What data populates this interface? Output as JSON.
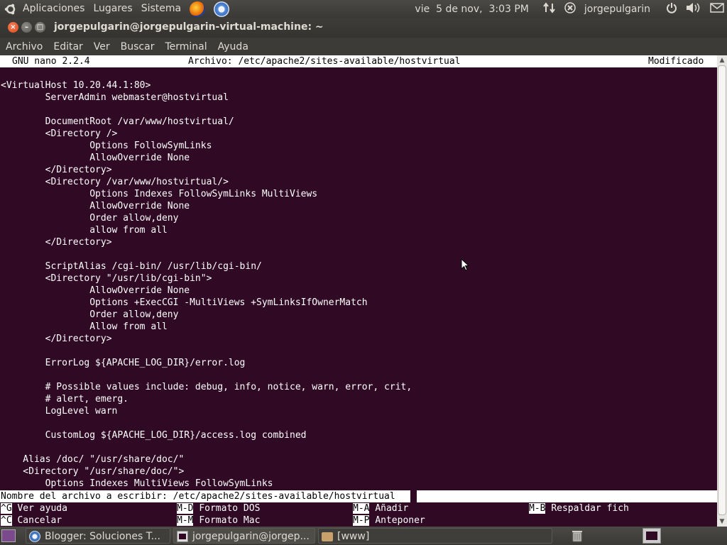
{
  "top_panel": {
    "menus": [
      "Aplicaciones",
      "Lugares",
      "Sistema"
    ],
    "datetime": "vie  5 de nov,  3:03 PM",
    "user": "jorgepulgarin"
  },
  "window": {
    "title": "jorgepulgarin@jorgepulgarin-virtual-machine: ~"
  },
  "menubar": [
    "Archivo",
    "Editar",
    "Ver",
    "Buscar",
    "Terminal",
    "Ayuda"
  ],
  "nano": {
    "version": "GNU nano 2.2.4",
    "file": "Archivo: /etc/apache2/sites-available/hostvirtual",
    "status": "Modificado",
    "lines": [
      "",
      "<VirtualHost 10.20.44.1:80>",
      "        ServerAdmin webmaster@hostvirtual",
      "",
      "        DocumentRoot /var/www/hostvirtual/",
      "        <Directory />",
      "                Options FollowSymLinks",
      "                AllowOverride None",
      "        </Directory>",
      "        <Directory /var/www/hostvirtual/>",
      "                Options Indexes FollowSymLinks MultiViews",
      "                AllowOverride None",
      "                Order allow,deny",
      "                allow from all",
      "        </Directory>",
      "",
      "        ScriptAlias /cgi-bin/ /usr/lib/cgi-bin/",
      "        <Directory \"/usr/lib/cgi-bin\">",
      "                AllowOverride None",
      "                Options +ExecCGI -MultiViews +SymLinksIfOwnerMatch",
      "                Order allow,deny",
      "                Allow from all",
      "        </Directory>",
      "",
      "        ErrorLog ${APACHE_LOG_DIR}/error.log",
      "",
      "        # Possible values include: debug, info, notice, warn, error, crit,",
      "        # alert, emerg.",
      "        LogLevel warn",
      "",
      "        CustomLog ${APACHE_LOG_DIR}/access.log combined",
      "",
      "    Alias /doc/ \"/usr/share/doc/\"",
      "    <Directory \"/usr/share/doc/\">",
      "        Options Indexes MultiViews FollowSymLinks"
    ],
    "prompt": "Nombre del archivo a escribir: /etc/apache2/sites-available/hostvirtual ",
    "shortcuts": [
      {
        "key": "^G",
        "label": "Ver ayuda"
      },
      {
        "key": "M-D",
        "label": "Formato DOS"
      },
      {
        "key": "M-A",
        "label": "Añadir"
      },
      {
        "key": "M-B",
        "label": "Respaldar fich"
      },
      {
        "key": "^C",
        "label": "Cancelar"
      },
      {
        "key": "M-M",
        "label": "Formato Mac"
      },
      {
        "key": "M-P",
        "label": "Anteponer"
      }
    ]
  },
  "taskbar": [
    {
      "label": "Blogger: Soluciones T...",
      "icon": "chromium-icon"
    },
    {
      "label": "jorgepulgarin@jorgep...",
      "icon": "terminal-icon"
    },
    {
      "label": "[www]",
      "icon": "folder-icon"
    }
  ]
}
